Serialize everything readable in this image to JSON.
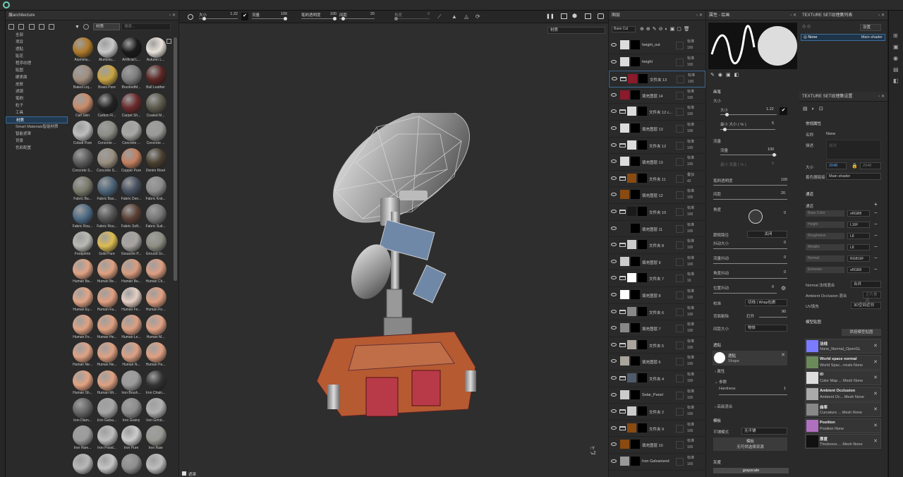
{
  "shelf": {
    "title": "展architecture",
    "search_placeholder": "搜索...",
    "filter_tag": "材质",
    "categories": [
      "全部",
      "项目",
      "透贴",
      "贴花",
      "程序纹理",
      "贴图",
      "硬表面",
      "皮肤",
      "滤镜",
      "笔刷",
      "粒子",
      "工具",
      "材质",
      "Smart Materials智能材质",
      "智能遮罩",
      "背景",
      "色彩配置"
    ],
    "selected_category": "材质",
    "materials": [
      {
        "label": "Aluminiu...",
        "color": "#b07a2a"
      },
      {
        "label": "Aluminiu...",
        "color": "#c8c8c8"
      },
      {
        "label": "Artificial L...",
        "color": "#1a1a1a"
      },
      {
        "label": "Autumn L...",
        "color": "#e9e2da"
      },
      {
        "label": "Baked Liq...",
        "color": "#a08e7f"
      },
      {
        "label": "Brass Pure",
        "color": "#c9a443"
      },
      {
        "label": "BrushedM...",
        "color": "#7d7d7d"
      },
      {
        "label": "Bull Leather",
        "color": "#5b2623"
      },
      {
        "label": "Calf Skin",
        "color": "#c98c6a"
      },
      {
        "label": "Carbon Fi...",
        "color": "#222222"
      },
      {
        "label": "Carpet Sh...",
        "color": "#6b2a2c"
      },
      {
        "label": "Coated M...",
        "color": "#5c5a4b"
      },
      {
        "label": "Cobalt Pure",
        "color": "#bdbdbd"
      },
      {
        "label": "Concrete ...",
        "color": "#8d8d86"
      },
      {
        "label": "Concrete ...",
        "color": "#a7a7a4"
      },
      {
        "label": "Concrete ...",
        "color": "#9a9a98"
      },
      {
        "label": "Concrete S...",
        "color": "#5b5b5b"
      },
      {
        "label": "Concrete S...",
        "color": "#9a8f80"
      },
      {
        "label": "Copper Pure",
        "color": "#c27f5e"
      },
      {
        "label": "Denim Rivet",
        "color": "#4a4030"
      },
      {
        "label": "Fabric Ba...",
        "color": "#7a7a6c"
      },
      {
        "label": "Fabric Bas...",
        "color": "#4b6478"
      },
      {
        "label": "Fabric Den...",
        "color": "#465060"
      },
      {
        "label": "Fabric Knit...",
        "color": "#8c8c8c"
      },
      {
        "label": "Fabric Rou...",
        "color": "#4d6b84"
      },
      {
        "label": "Fabric Rou...",
        "color": "#555555"
      },
      {
        "label": "Fabric Soft...",
        "color": "#5a4035"
      },
      {
        "label": "Fabric Suit...",
        "color": "#777777"
      },
      {
        "label": "Footprints",
        "color": "#b9b9b4"
      },
      {
        "label": "Gold Pure",
        "color": "#dcbc52"
      },
      {
        "label": "Gouache P...",
        "color": "#a7a4a0"
      },
      {
        "label": "Ground Gr...",
        "color": "#8e8e83"
      },
      {
        "label": "Human Ba...",
        "color": "#e0a384"
      },
      {
        "label": "Human Be...",
        "color": "#dfa080"
      },
      {
        "label": "Human Bu...",
        "color": "#d99c7e"
      },
      {
        "label": "Human Ch...",
        "color": "#dd9e81"
      },
      {
        "label": "Human Ey...",
        "color": "#e2a587"
      },
      {
        "label": "Human Fa...",
        "color": "#df9f80"
      },
      {
        "label": "Human Fe...",
        "color": "#e5cfc3"
      },
      {
        "label": "Human Fo...",
        "color": "#e0a082"
      },
      {
        "label": "Human Fo...",
        "color": "#dea282"
      },
      {
        "label": "Human He...",
        "color": "#dea080"
      },
      {
        "label": "Human Le...",
        "color": "#dc9f82"
      },
      {
        "label": "Human M...",
        "color": "#e0a184"
      },
      {
        "label": "Human Ne...",
        "color": "#dea283"
      },
      {
        "label": "Human Ne...",
        "color": "#dfa081"
      },
      {
        "label": "Human N...",
        "color": "#dca084"
      },
      {
        "label": "Human Pa...",
        "color": "#e0a082"
      },
      {
        "label": "Human Sh...",
        "color": "#e2a281"
      },
      {
        "label": "Human Wr...",
        "color": "#dea181"
      },
      {
        "label": "Iron Brush...",
        "color": "#9a9a9a"
      },
      {
        "label": "Iron Chain...",
        "color": "#333333"
      },
      {
        "label": "Iron Diam...",
        "color": "#666666"
      },
      {
        "label": "Iron Galva...",
        "color": "#a5a5a5"
      },
      {
        "label": "Iron Grainy",
        "color": "#8c8c8c"
      },
      {
        "label": "Iron Grind...",
        "color": "#b0b0b0"
      },
      {
        "label": "Iron Ham...",
        "color": "#9c9c9c"
      },
      {
        "label": "Iron Powd...",
        "color": "#bdbdbd"
      },
      {
        "label": "Iron Pure",
        "color": "#cccccc"
      },
      {
        "label": "Iron Raw",
        "color": "#9a9a94"
      },
      {
        "label": "",
        "color": "#b8b8b8"
      },
      {
        "label": "",
        "color": "#c5c5c5"
      },
      {
        "label": "",
        "color": "#8d8d8d"
      },
      {
        "label": "",
        "color": "#bdbdbd"
      }
    ]
  },
  "viewport": {
    "toolbar": {
      "size_label": "大小",
      "size_value": "1.22",
      "flow_label": "流量",
      "flow_value": "100",
      "opacity_label": "笔刷透明度",
      "opacity_value": "100",
      "spacing_label": "间距",
      "spacing_value": "20",
      "angle_label": "角度",
      "angle_value": "0"
    },
    "mode_dropdown": "材质",
    "footer": "遮罩"
  },
  "layers": {
    "title": "图层",
    "channel_dropdown": "Base Col",
    "rows": [
      {
        "name": "height_out",
        "blend": "标准",
        "opacity": "100",
        "thumb": "#dcdcdc",
        "folder": false,
        "sel": false
      },
      {
        "name": "height",
        "blend": "标准",
        "opacity": "100",
        "thumb": "#dcdcdc",
        "folder": false,
        "sel": false
      },
      {
        "name": "文件夹 13",
        "blend": "标准",
        "opacity": "100",
        "thumb": "#8b1a2b",
        "folder": true,
        "sel": true
      },
      {
        "name": "填充图层 14",
        "blend": "标准",
        "opacity": "100",
        "thumb": "#8b1a2b",
        "folder": false,
        "sel": false
      },
      {
        "name": "文件夹 12 c...",
        "blend": "标准",
        "opacity": "100",
        "thumb": "#dcdcdc",
        "folder": true,
        "sel": false
      },
      {
        "name": "填充图层 13",
        "blend": "标准",
        "opacity": "100",
        "thumb": "#dcdcdc",
        "folder": false,
        "sel": false
      },
      {
        "name": "文件夹 12",
        "blend": "标准",
        "opacity": "100",
        "thumb": "#dcdcdc",
        "folder": true,
        "sel": false
      },
      {
        "name": "填充图层 13",
        "blend": "标准",
        "opacity": "100",
        "thumb": "#dcdcdc",
        "folder": false,
        "sel": false
      },
      {
        "name": "文件夹 11",
        "blend": "叠加",
        "opacity": "42",
        "thumb": "#8a4a10",
        "folder": true,
        "sel": false
      },
      {
        "name": "填充图层 12",
        "blend": "标准",
        "opacity": "100",
        "thumb": "#8a4a10",
        "folder": false,
        "sel": false
      },
      {
        "name": "文件夹 10",
        "blend": "标准",
        "opacity": "100",
        "thumb": "#1a1a1a",
        "folder": true,
        "sel": false
      },
      {
        "name": "填充图层 11",
        "blend": "标准",
        "opacity": "100",
        "thumb": "#2a2a2a",
        "folder": false,
        "sel": false
      },
      {
        "name": "文件夹 8",
        "blend": "标准",
        "opacity": "100",
        "thumb": "#cccccc",
        "folder": true,
        "sel": false
      },
      {
        "name": "填充图层 9",
        "blend": "标准",
        "opacity": "100",
        "thumb": "#cccccc",
        "folder": false,
        "sel": false
      },
      {
        "name": "文件夹 7",
        "blend": "标准",
        "opacity": "16",
        "thumb": "#ffffff",
        "folder": true,
        "sel": false
      },
      {
        "name": "填充图层 8",
        "blend": "标准",
        "opacity": "100",
        "thumb": "#ffffff",
        "folder": false,
        "sel": false
      },
      {
        "name": "文件夹 6",
        "blend": "标准",
        "opacity": "100",
        "thumb": "#888888",
        "folder": true,
        "sel": false
      },
      {
        "name": "填充图层 7",
        "blend": "标准",
        "opacity": "100",
        "thumb": "#888888",
        "folder": false,
        "sel": false
      },
      {
        "name": "文件夹 5",
        "blend": "标准",
        "opacity": "100",
        "thumb": "#aaa59c",
        "folder": true,
        "sel": false
      },
      {
        "name": "填充图层 6",
        "blend": "标准",
        "opacity": "100",
        "thumb": "#aaa59c",
        "folder": false,
        "sel": false
      },
      {
        "name": "文件夹 4",
        "blend": "标准",
        "opacity": "100",
        "thumb": "#4f5b6a",
        "folder": true,
        "sel": false
      },
      {
        "name": "Solar_Panel",
        "blend": "标准",
        "opacity": "100",
        "thumb": "#cccccc",
        "folder": false,
        "sel": false
      },
      {
        "name": "文件夹 2",
        "blend": "标准",
        "opacity": "100",
        "thumb": "#cccccc",
        "folder": true,
        "sel": false
      },
      {
        "name": "文件夹 9",
        "blend": "标准",
        "opacity": "100",
        "thumb": "#8a4a10",
        "folder": true,
        "sel": false
      },
      {
        "name": "填充图层 10",
        "blend": "标准",
        "opacity": "100",
        "thumb": "#8a4a10",
        "folder": false,
        "sel": false
      },
      {
        "name": "Iron Galvanized",
        "blend": "标准",
        "opacity": "100",
        "thumb": "#999999",
        "folder": false,
        "sel": false
      }
    ]
  },
  "props": {
    "title": "属性 - 绘画",
    "brush_section": "画笔",
    "size_label": "大小",
    "size_sub": "大小",
    "size_value": "1.22",
    "min_size_label": "最小 大小 ( % )",
    "min_size_value": "5",
    "flow_label": "流量",
    "flow_sub": "流量",
    "flow_value": "100",
    "min_flow_label": "最小 流量 ( % )",
    "min_flow_value": "5",
    "opacity_label": "笔刷透明度",
    "opacity_value": "100",
    "spacing_label": "间距",
    "spacing_value": "20",
    "angle_label": "角度",
    "angle_value": "0",
    "follow_path_label": "跟随路径",
    "follow_path_value": "关闭",
    "jitter_size_label": "抖动大小",
    "jitter_size_value": "0",
    "jitter_flow_label": "流量抖动",
    "jitter_flow_value": "0",
    "jitter_angle_label": "角度抖动",
    "jitter_angle_value": "0",
    "jitter_pos_label": "位置抖动",
    "jitter_pos_value": "0",
    "alignment_label": "校准",
    "alignment_value": "切线 | Wrap包裹",
    "backface_label": "背面剔除",
    "backface_value": "打开",
    "backface_num": "90",
    "spacing_size_label": "间距大小",
    "spacing_size_value": "物体",
    "alpha_section": "透贴",
    "alpha_name": "透贴",
    "alpha_sub": "Shape",
    "attr_label": "属性",
    "params_label": "参数",
    "hardness_label": "Hardness",
    "hardness_value": "1",
    "adv_blend_label": "高级混合",
    "stencil_section": "模板",
    "tiling_label": "平铺模式",
    "tiling_value": "无平铺",
    "stencil_btn_line1": "模板",
    "stencil_btn_line2": "无可供选择资源",
    "gray_section": "灰度",
    "gray_value": "grayscale"
  },
  "tslist": {
    "title": "TEXTURE SET纹理集列表",
    "settings_btn": "设置",
    "item_name": "None",
    "item_shader": "Main shader"
  },
  "tsset": {
    "title": "TEXTURE SET纹理集设置",
    "common_section": "常规属性",
    "name_label": "名称",
    "name_value": "None",
    "desc_label": "描述",
    "desc_placeholder": "描述",
    "size_label": "大小",
    "size_value": "2048",
    "size_value2": "2048",
    "shader_label": "着色器链接",
    "shader_value": "Main shader",
    "channels_section": "通道",
    "channels_sub": "通道",
    "channels": [
      {
        "name": "Base Color",
        "format": "sRGB8"
      },
      {
        "name": "Height",
        "format": "L16F"
      },
      {
        "name": "Roughness",
        "format": "L8"
      },
      {
        "name": "Metallic",
        "format": "L8"
      },
      {
        "name": "Normal",
        "format": "RGB16F"
      },
      {
        "name": "Emissive",
        "format": "sRGB8"
      }
    ],
    "normal_mix_label": "Normal 法线混合",
    "normal_mix_value": "合并",
    "ao_mix_label": "Ambient Occlusion 混合",
    "ao_mix_value": "正片叠底",
    "uv_label": "UV填充",
    "uv_value": "3D空间近邻",
    "mesh_maps_section": "模型贴图",
    "bake_btn": "烘焙模型贴图",
    "maps": [
      {
        "name": "法线",
        "sub": "None_Normal_OpenGL",
        "color": "#7b7bff"
      },
      {
        "name": "World space normal",
        "sub": "World Spac...rmals None",
        "color": "#6a8a5a"
      },
      {
        "name": "ID",
        "sub": "Color Map ... Mesh None",
        "color": "#dddddd"
      },
      {
        "name": "Ambient Occlusion",
        "sub": "Ambient Oc... Mesh None",
        "color": "#aaaaaa"
      },
      {
        "name": "曲率",
        "sub": "Curvature ... Mesh None",
        "color": "#888888"
      },
      {
        "name": "Position",
        "sub": "Position None",
        "color": "#b070c0"
      },
      {
        "name": "厚度",
        "sub": "Thickness ... Mesh None",
        "color": "#111111"
      }
    ]
  }
}
